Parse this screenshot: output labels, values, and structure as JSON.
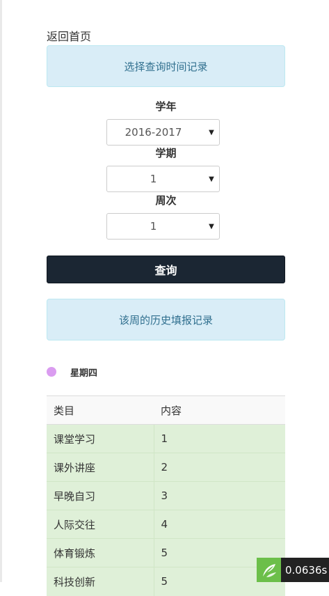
{
  "nav": {
    "back_label": "返回首页"
  },
  "query_panel": {
    "title": "选择查询时间记录",
    "year_label": "学年",
    "year_value": "2016-2017",
    "term_label": "学期",
    "term_value": "1",
    "week_label": "周次",
    "week_value": "1",
    "select_arrow": "▼",
    "submit_label": "查询"
  },
  "history": {
    "title": "该周的历史填报记录",
    "day_label": "星期四",
    "day_dot_color": "#da9cf0",
    "columns": {
      "category": "类目",
      "content": "内容"
    },
    "rows": [
      {
        "category": "课堂学习",
        "content": "1"
      },
      {
        "category": "课外讲座",
        "content": "2"
      },
      {
        "category": "早晚自习",
        "content": "3"
      },
      {
        "category": "人际交往",
        "content": "4"
      },
      {
        "category": "体育锻炼",
        "content": "5"
      },
      {
        "category": "科技创新",
        "content": "5"
      }
    ]
  },
  "timer_badge": {
    "icon": "leaf-logo-icon",
    "text": "0.0636s"
  },
  "colors": {
    "info_bg": "#d9edf7",
    "info_text": "#31708f",
    "button_bg": "#1b2633",
    "row_bg": "#dff0d8"
  }
}
